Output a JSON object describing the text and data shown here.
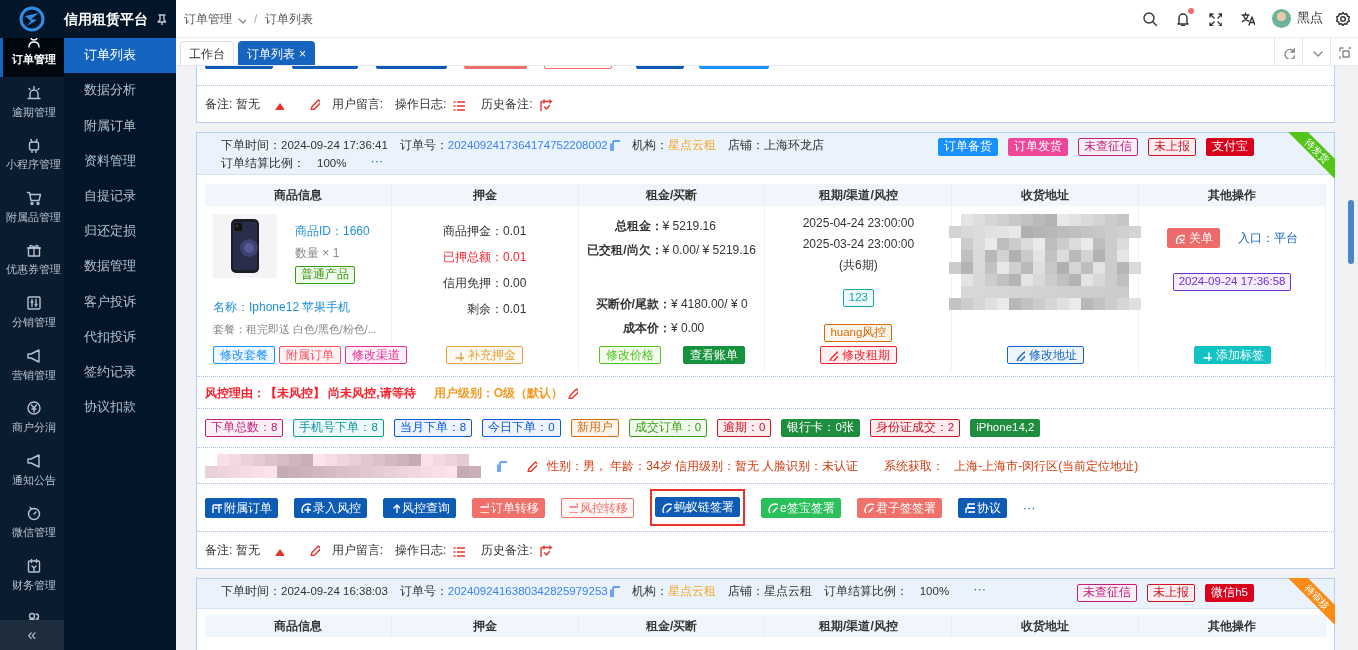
{
  "app": {
    "title": "信用租赁平台",
    "collapse": "«"
  },
  "main_menu": [
    {
      "label": "订单管理",
      "selected": true
    },
    {
      "label": "逾期管理",
      "selected": false
    },
    {
      "label": "小程序管理",
      "selected": false
    },
    {
      "label": "附属品管理",
      "selected": false
    },
    {
      "label": "优惠券管理",
      "selected": false
    },
    {
      "label": "分销管理",
      "selected": false
    },
    {
      "label": "营销管理",
      "selected": false
    },
    {
      "label": "商户分润",
      "selected": false
    },
    {
      "label": "通知公告",
      "selected": false
    },
    {
      "label": "微信管理",
      "selected": false
    },
    {
      "label": "财务管理",
      "selected": false
    }
  ],
  "sub_menu": [
    {
      "label": "订单列表",
      "selected": true
    },
    {
      "label": "数据分析",
      "selected": false
    },
    {
      "label": "附属订单",
      "selected": false
    },
    {
      "label": "资料管理",
      "selected": false
    },
    {
      "label": "自提记录",
      "selected": false
    },
    {
      "label": "归还定损",
      "selected": false
    },
    {
      "label": "数据管理",
      "selected": false
    },
    {
      "label": "客户投诉",
      "selected": false
    },
    {
      "label": "代扣投诉",
      "selected": false
    },
    {
      "label": "签约记录",
      "selected": false
    },
    {
      "label": "协议扣款",
      "selected": false
    }
  ],
  "breadcrumb": {
    "items": [
      "订单管理",
      "订单列表"
    ],
    "separator": "/"
  },
  "user": {
    "name": "黑点",
    "unread_notifications": true
  },
  "tabs": [
    {
      "label": "工作台",
      "selected": false
    },
    {
      "label": "订单列表",
      "selected": true,
      "close": "×"
    }
  ],
  "orders": [
    {
      "kind": "partial_bottom",
      "cut_buttons": [
        {
          "kind": "solid",
          "color": "#0d5bb5"
        },
        {
          "kind": "solid",
          "color": "#0d5bb5"
        },
        {
          "kind": "solid",
          "color": "#0d5bb5"
        },
        {
          "kind": "solid",
          "color": "#f0706b"
        },
        {
          "kind": "outline",
          "color": "#f0706b"
        },
        {
          "kind": "solid",
          "color": "#0d5bb5"
        },
        {
          "kind": "solid",
          "color": "#1e90ff"
        }
      ],
      "notes": {
        "remark": "备注: 暂无",
        "message": "用户留言:",
        "log": "操作日志:",
        "history": "历史备注:"
      }
    },
    {
      "kind": "full",
      "header": {
        "time_label": "下单时间：",
        "time": "2024-09-24 17:36:41",
        "no_label": "订单号：",
        "no": "2024092417364174752208002",
        "org_label": "机构：",
        "org": "星点云租",
        "shop_label": "店铺：",
        "shop": "上海环龙店",
        "ratio_label": "订单结算比例：",
        "ratio": "100%",
        "more": "···"
      },
      "tags": [
        {
          "text": "订单备货",
          "kind": "solid",
          "color": "#1890ff"
        },
        {
          "text": "订单发货",
          "kind": "solid",
          "color": "#f0469a"
        },
        {
          "text": "未查征信",
          "kind": "outline",
          "color": "#c41d7f"
        },
        {
          "text": "未上报",
          "kind": "outline",
          "color": "#cf1322"
        },
        {
          "text": "支付宝",
          "kind": "solid",
          "color": "#d9001b"
        }
      ],
      "ribbon": {
        "text": "待发货",
        "color": "#52c41a"
      },
      "columns": [
        "商品信息",
        "押金",
        "租金/买断",
        "租期/渠道/风控",
        "收货地址",
        "其他操作"
      ],
      "product": {
        "id": "商品ID：1660",
        "qty": "数量 × 1",
        "type_tag": "普通产品",
        "name": "名称：Iphone12 苹果手机",
        "package": "套餐：租完即送 白色/黑色/粉色/...",
        "buttons": [
          {
            "label": "修改套餐",
            "kind": "outline",
            "color": "#1890ff"
          },
          {
            "label": "附属订单",
            "kind": "outline",
            "color": "#f5515f"
          },
          {
            "label": "修改渠道",
            "kind": "outline",
            "color": "#eb2f96"
          }
        ]
      },
      "deposit": {
        "lines": [
          {
            "label": "商品押金：",
            "value": "0.01",
            "alert": false
          },
          {
            "label": "已押总额：",
            "value": "0.01",
            "alert": true
          },
          {
            "label": "信用免押：",
            "value": "0.00",
            "alert": false
          },
          {
            "label": "剩余：",
            "value": "0.01",
            "alert": false
          }
        ],
        "button": {
          "label": "补充押金",
          "kind": "outline",
          "color": "#e6a23c"
        }
      },
      "rent": {
        "top": [
          {
            "label": "总租金：",
            "value": "¥ 5219.16"
          },
          {
            "label": "已交租/尚欠：",
            "value": "¥ 0.00/ ¥ 5219.16"
          }
        ],
        "bottom": [
          {
            "label": "买断价/尾款：",
            "value": "¥ 4180.00/ ¥ 0"
          },
          {
            "label": "成本价：",
            "value": "¥ 0.00"
          }
        ],
        "buttons": [
          {
            "label": "修改价格",
            "kind": "outline",
            "color": "#52c41a"
          },
          {
            "label": "查看账单",
            "kind": "solid",
            "color": "#16913c"
          }
        ]
      },
      "term": {
        "dates": [
          "2025-04-24 23:00:00",
          "2025-03-24 23:00:00",
          "(共6期)"
        ],
        "tags": [
          {
            "text": "123",
            "kind": "outline",
            "color": "#13a8a8"
          },
          {
            "text": "huang风控",
            "kind": "outline",
            "color": "#d46b08"
          }
        ],
        "button": {
          "label": "修改租期",
          "kind": "outline",
          "color": "#f5222d"
        }
      },
      "address": {
        "button": {
          "label": "修改地址",
          "kind": "outline",
          "color": "#1565c0"
        }
      },
      "other": {
        "close_button": {
          "label": "关单",
          "kind": "solid",
          "color": "#ee6b6b"
        },
        "entry": "入口：平台",
        "time_tag": {
          "text": "2024-09-24 17:36:58",
          "kind": "outline",
          "color": "#722ed1"
        },
        "button": {
          "label": "添加标签",
          "kind": "solid",
          "color": "#13c2c2"
        }
      },
      "risk": {
        "reason": "风控理由：【未风控】 尚未风控,请等待",
        "level": "用户级别：O级（默认）"
      },
      "stats": [
        {
          "text": "下单总数：8",
          "kind": "outline",
          "color": "#c41d7f"
        },
        {
          "text": "手机号下单：8",
          "kind": "outline",
          "color": "#08979c"
        },
        {
          "text": "当月下单：8",
          "kind": "outline",
          "color": "#0958d9"
        },
        {
          "text": "今日下单：0",
          "kind": "outline",
          "color": "#0958d9"
        },
        {
          "text": "新用户",
          "kind": "outline",
          "color": "#d46b08"
        },
        {
          "text": "成交订单：0",
          "kind": "outline",
          "color": "#389e0d"
        },
        {
          "text": "逾期：0",
          "kind": "outline",
          "color": "#cf1322"
        },
        {
          "text": "银行卡：0张",
          "kind": "solid",
          "color": "#1e8e3e"
        },
        {
          "text": "身份证成交：2",
          "kind": "outline",
          "color": "#cf1322"
        },
        {
          "text": "iPhone14,2",
          "kind": "solid",
          "color": "#1e8e3e"
        }
      ],
      "customer": {
        "info": "性别：男， 年龄：34岁 信用级别：暂无 人脸识别：未认证",
        "source_label": "系统获取：",
        "location": "上海-上海市-闵行区(当前定位地址)"
      },
      "actions": [
        {
          "label": "附属订单",
          "kind": "solid",
          "color": "#0d5bb5",
          "highlighted": false
        },
        {
          "label": "录入风控",
          "kind": "solid",
          "color": "#0d5bb5",
          "highlighted": false
        },
        {
          "label": "风控查询",
          "kind": "solid",
          "color": "#0d5bb5",
          "highlighted": false
        },
        {
          "label": "订单转移",
          "kind": "solid",
          "color": "#f0706b",
          "highlighted": false
        },
        {
          "label": "风控转移",
          "kind": "outline",
          "color": "#f0706b",
          "highlighted": false
        },
        {
          "label": "蚂蚁链签署",
          "kind": "solid",
          "color": "#0d5bb5",
          "highlighted": true
        },
        {
          "label": "e签宝签署",
          "kind": "solid",
          "color": "#2bc05b",
          "highlighted": false
        },
        {
          "label": "君子签签署",
          "kind": "solid",
          "color": "#f0706b",
          "highlighted": false
        },
        {
          "label": "协议",
          "kind": "solid",
          "color": "#0d5bb5",
          "highlighted": false
        }
      ],
      "more": "···",
      "notes": {
        "remark": "备注: 暂无",
        "message": "用户留言:",
        "log": "操作日志:",
        "history": "历史备注:"
      }
    },
    {
      "kind": "partial_top",
      "header": {
        "time_label": "下单时间：",
        "time": "2024-09-24 16:38:03",
        "no_label": "订单号：",
        "no": "2024092416380342825979253",
        "org_label": "机构：",
        "org": "星点云租",
        "shop_label": "店铺：",
        "shop": "星点云租",
        "ratio_label": "订单结算比例：",
        "ratio": "100%",
        "more": "···"
      },
      "tags": [
        {
          "text": "未查征信",
          "kind": "outline",
          "color": "#c41d7f"
        },
        {
          "text": "未上报",
          "kind": "outline",
          "color": "#cf1322"
        },
        {
          "text": "微信h5",
          "kind": "solid",
          "color": "#d9001b"
        }
      ],
      "ribbon": {
        "text": "待审核",
        "color": "#fa8c16"
      },
      "columns": [
        "商品信息",
        "押金",
        "租金/买断",
        "租期/渠道/风控",
        "收货地址",
        "其他操作"
      ]
    }
  ]
}
